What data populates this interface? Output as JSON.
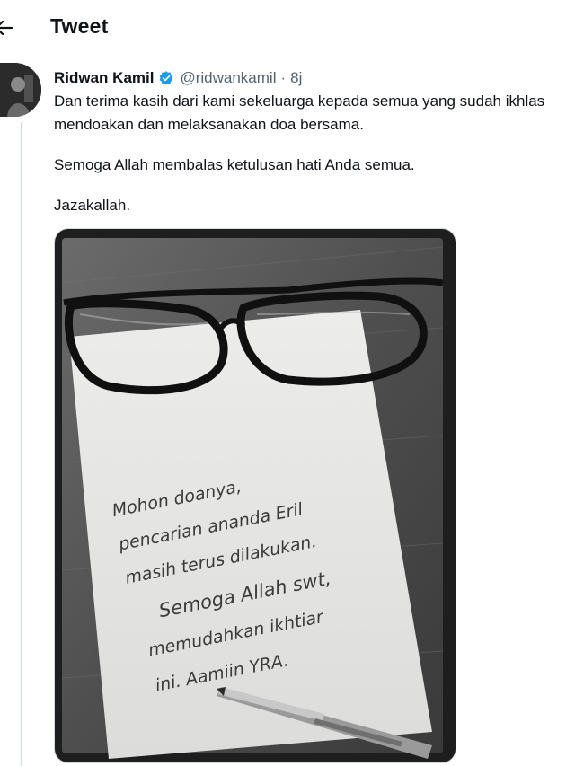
{
  "header": {
    "title": "Tweet",
    "back_icon": "arrow-left-icon"
  },
  "tweet": {
    "author_name": "Ridwan Kamil",
    "verified_icon": "verified-badge-icon",
    "handle": "@ridwankamil",
    "separator": "·",
    "time": "8j",
    "text_lines": [
      "Dan terima kasih dari kami sekeluarga kepada semua yang sudah ikhlas",
      "mendoakan dan melaksanakan doa bersama.",
      "Semoga Allah membalas ketulusan hati Anda semua.",
      "Jazakallah."
    ],
    "media": {
      "handwritten_note": [
        "Mohon doanya,",
        "pencarian ananda Eril",
        "masih terus dilakukan.",
        "Semoga Allah swt,",
        "memudahkan ikhtiar",
        "ini. Aamiin YRA."
      ]
    }
  },
  "colors": {
    "text": "#0f1419",
    "secondary_text": "#536471",
    "verified_blue": "#1d9bf0",
    "border": "#cfd9de"
  }
}
